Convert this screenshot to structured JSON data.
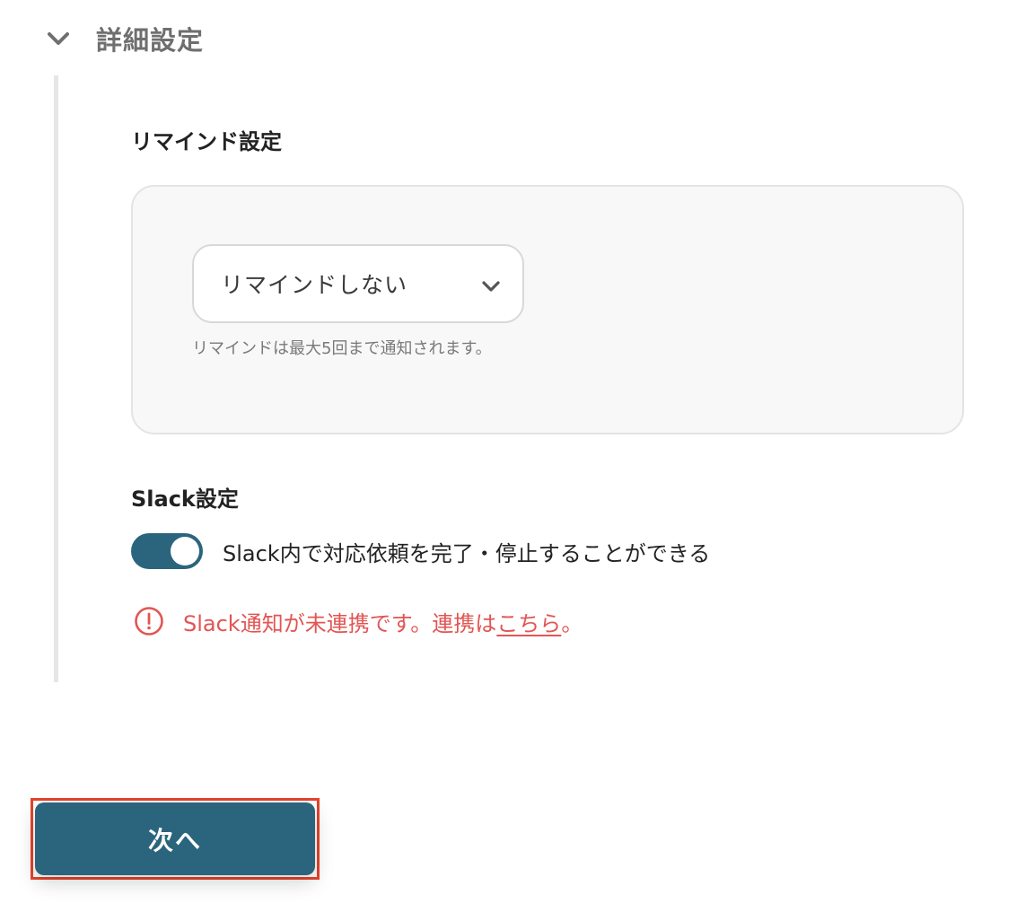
{
  "section": {
    "title": "詳細設定",
    "chevron_icon": "chevron-down-icon"
  },
  "remind": {
    "heading": "リマインド設定",
    "select_value": "リマインドしない",
    "hint": "リマインドは最大5回まで通知されます。"
  },
  "slack": {
    "heading": "Slack設定",
    "toggle_state": "on",
    "toggle_label": "Slack内で対応依頼を完了・停止することができる",
    "warning_prefix": "Slack通知が未連携です。連携は",
    "warning_link": "こちら",
    "warning_suffix": "。",
    "warning_icon": "exclamation-circle-icon"
  },
  "footer": {
    "next_label": "次へ"
  },
  "colors": {
    "accent": "#2b657d",
    "warning": "#e25553",
    "highlight_border": "#e5432c"
  }
}
